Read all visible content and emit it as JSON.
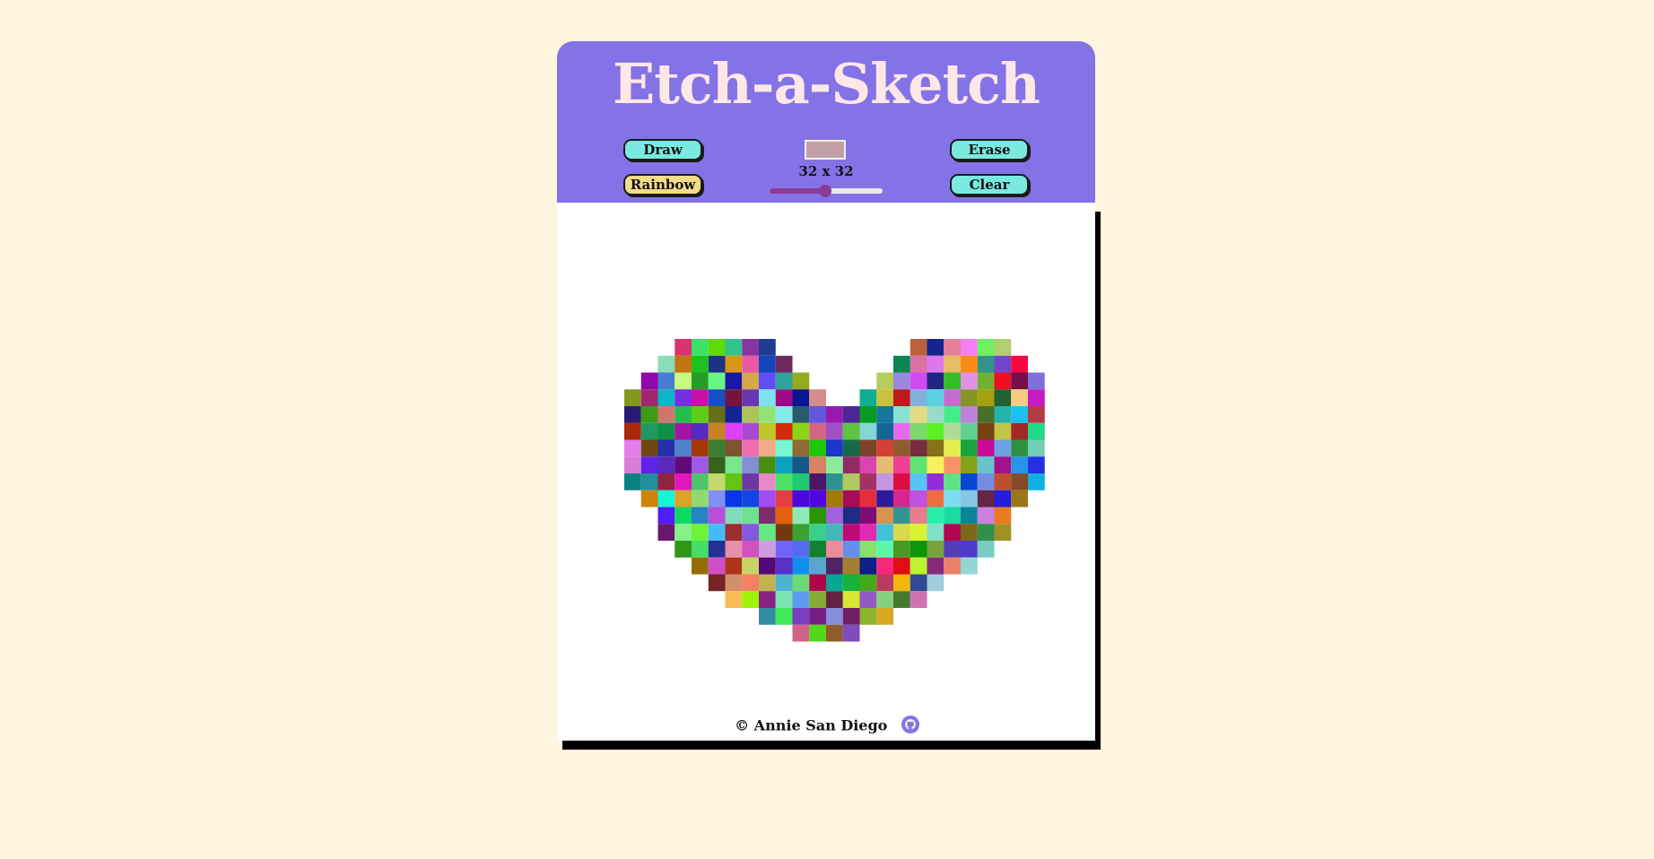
{
  "app": {
    "title": "Etch-a-Sketch"
  },
  "controls": {
    "draw_label": "Draw",
    "rainbow_label": "Rainbow",
    "erase_label": "Erase",
    "clear_label": "Clear",
    "size_label": "32 x 32",
    "grid_size": 32,
    "slider_min": 1,
    "slider_max": 64,
    "slider_value": 32,
    "picked_color": "#c2a0a8"
  },
  "footer": {
    "credit": "© Annie San Diego",
    "icon": "github-icon"
  },
  "colors": {
    "background": "#fff4df",
    "header": "#8473e6",
    "title": "#fde7e7",
    "button": "#7ae9e0",
    "button_active": "#f4dc88",
    "slider": "#8a3c96"
  },
  "drawing": {
    "shape": "heart",
    "mode": "rainbow"
  }
}
